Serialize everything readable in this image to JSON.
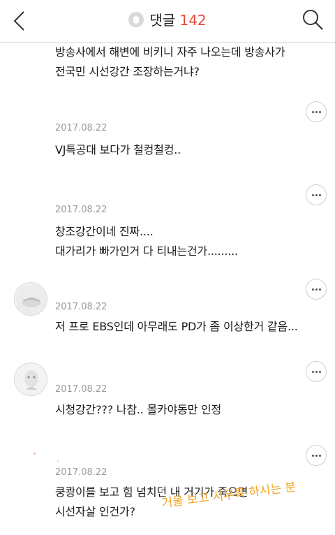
{
  "header": {
    "title": "댓글",
    "count": "142"
  },
  "comments": [
    {
      "date": "",
      "text": "방송사에서 해변에 비키니 자주 나오는데 방송사가\n전국민 시선강간 조장하는거냐?"
    },
    {
      "date": "2017.08.22",
      "text": "VJ특공대 보다가 철컹철컹.."
    },
    {
      "date": "2017.08.22",
      "text": "창조강간이네 진짜....\n대가리가 빠가인거 다 티내는건가........."
    },
    {
      "date": "2017.08.22",
      "text": "저 프로 EBS인데 아무래도 PD가 좀 이상한거 같음..."
    },
    {
      "date": "2017.08.22",
      "text": "시청강간??? 나참.. 몰카야동만 인정"
    },
    {
      "date": "2017.08.22",
      "text": "쿵쾅이를 보고 힘 넘치던 내 거기가 죽으면\n시선자살 인건가?"
    }
  ],
  "overlay": {
    "handwritten_note": "거울 보고 시무룩 하시는 분"
  },
  "colors": {
    "accent": "#e8473c",
    "note": "#f2a623"
  }
}
